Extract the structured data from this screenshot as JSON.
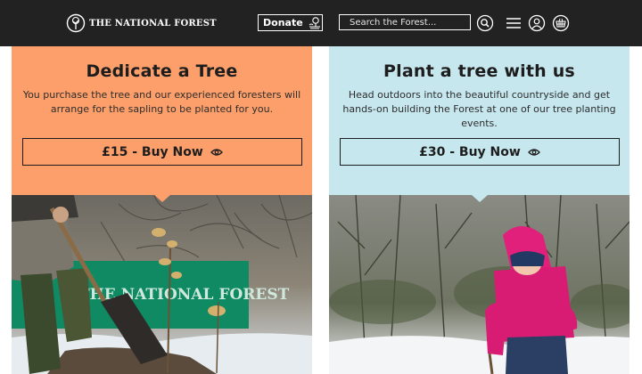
{
  "header": {
    "logo_text": "THE NATIONAL FOREST",
    "donate_label": "Donate",
    "search_placeholder": "Search the Forest...",
    "icons": [
      "tree-logo-icon",
      "donate-tree-icon",
      "search-icon",
      "menu-icon",
      "account-icon",
      "basket-icon"
    ]
  },
  "cards": [
    {
      "title": "Dedicate a Tree",
      "description": "You purchase the tree and our experienced foresters will arrange for the sapling to be planted for you.",
      "button_label": "£15 - Buy Now",
      "background": "#fd9f6a",
      "photo": {
        "banner_text": "THE NATIONAL FOREST",
        "banner_color": "#0f8a63"
      }
    },
    {
      "title": "Plant a tree with us",
      "description": "Head outdoors into the beautiful countryside and get hands-on building the Forest at one of our tree planting events.",
      "button_label": "£30 - Buy Now",
      "background": "#c7e7ee",
      "photo": {
        "jacket_color": "#e0207a"
      }
    }
  ],
  "colors": {
    "header_bg": "#222222",
    "text_dark": "#1d1d1d"
  }
}
